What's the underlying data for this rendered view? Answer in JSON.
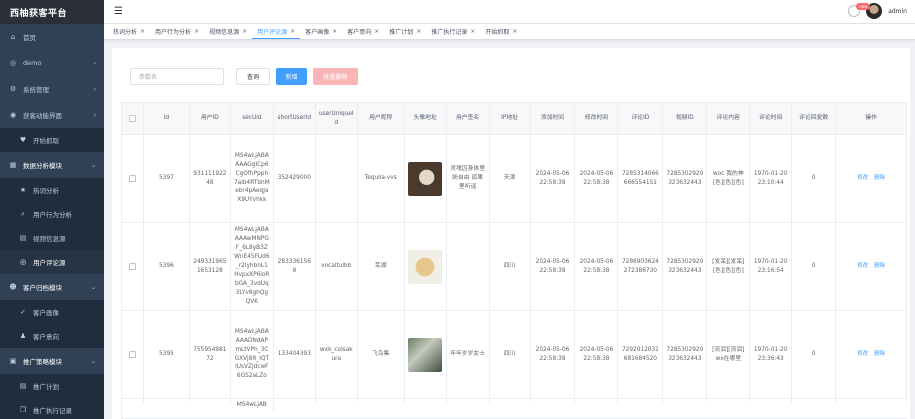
{
  "app": {
    "logo_text": "西柚获客平台"
  },
  "sidebar": {
    "items": [
      {
        "label": "首页",
        "icon": "home-icon"
      },
      {
        "label": "demo",
        "icon": "circle-icon",
        "arrow": "›"
      },
      {
        "label": "系统管理",
        "icon": "gear-icon",
        "arrow": "›"
      },
      {
        "label": "获客动能界面",
        "icon": "circle-icon",
        "arrow": "›"
      }
    ],
    "sub_open_label": "开始抓取",
    "group_data": {
      "label": "数据分析模块",
      "arrow": "⌄"
    },
    "data_subitems": [
      {
        "label": "热词分析",
        "icon": "star-icon"
      },
      {
        "label": "用户行为分析",
        "icon": "search-icon"
      },
      {
        "label": "视频信息源",
        "icon": "doc-icon"
      },
      {
        "label": "用户评论源",
        "icon": "target-icon",
        "active": true
      }
    ],
    "group_customer": {
      "label": "客户归档模块",
      "arrow": "⌄"
    },
    "customer_subitems": [
      {
        "label": "客户画像",
        "icon": "check-icon"
      },
      {
        "label": "客户意向",
        "icon": "person-icon"
      }
    ],
    "group_promo": {
      "label": "推广策略模块",
      "arrow": "⌄"
    },
    "promo_subitems": [
      {
        "label": "推广计划",
        "icon": "doc-icon"
      },
      {
        "label": "推广执行记录",
        "icon": "cube-icon"
      }
    ]
  },
  "topbar": {
    "badge": "new",
    "username": "admin"
  },
  "tabs": [
    {
      "label": "热词分析",
      "close": "×"
    },
    {
      "label": "用户行为分析",
      "close": "×"
    },
    {
      "label": "视频信息源",
      "close": "×"
    },
    {
      "label": "用户评论源",
      "close": "×",
      "active": true
    },
    {
      "label": "客户画像",
      "close": "×"
    },
    {
      "label": "客户意向",
      "close": "×"
    },
    {
      "label": "推广计划",
      "close": "×"
    },
    {
      "label": "推广执行记录",
      "close": "×"
    },
    {
      "label": "开始抓取",
      "close": "×"
    }
  ],
  "toolbar": {
    "search_placeholder": "参数名",
    "query_label": "查询",
    "add_label": "新增",
    "batch_delete_label": "批量删除"
  },
  "table": {
    "headers": [
      "id",
      "用户ID",
      "secUid",
      "shortUserId",
      "userUniqueId",
      "用户昵称",
      "头像地址",
      "用户签名",
      "IP地址",
      "添加时间",
      "修改时间",
      "评论ID",
      "视频ID",
      "评论内容",
      "评论时间",
      "评论回复数",
      "操作"
    ],
    "edit_label": "修改",
    "delete_label": "删除",
    "rows": [
      {
        "id": "5397",
        "uid": "93111192248",
        "secuid": "MS4wLjABAAAAGglCp6CgOfhPpph7alb4RTbhMebr4pAeqJaX9UYvhkk",
        "short_uid": "352429000",
        "unique_id": "",
        "nickname": "Tequila-vvs",
        "avatar": "photo-portrait",
        "signature": "灵魂囚身体里盼自由 孤果里听谣",
        "ip": "天津",
        "add_time": "2024-05-06 22:58:38",
        "mod_time": "2024-05-06 22:58:38",
        "comment_id": "7285314066666554151",
        "video_id": "7285302920323632443",
        "content": "woc 我的神[色][色][色]",
        "comment_time": "1970-01-20 23:10:44",
        "reply_count": "0"
      },
      {
        "id": "5396",
        "uid": "2493319651653128",
        "secuid": "MS4wLjABAAAAwMNPGF_6L8yB3ZWnE45FUd6_r2lyhbnL1HvpxXP6loRbGA_3vdUq3LYv8ghQgQVK",
        "short_uid": "2833361569",
        "unique_id": "vocaltulbb",
        "nickname": "芜湖",
        "avatar": "photo-dog",
        "signature": "",
        "ip": "四川",
        "add_time": "2024-05-06 22:58:38",
        "mod_time": "2024-05-06 22:58:38",
        "comment_id": "7286903624272386730",
        "video_id": "7285302920323632443",
        "content": "[发呆][发呆][色][色][色]",
        "comment_time": "1970-01-20 23:16:54",
        "reply_count": "0"
      },
      {
        "id": "5395",
        "uid": "75595498172",
        "secuid": "MS4wLjABAAAADNdAPmLtVPh_3CGXVj8R_IQTlUsVZjdcwF6GS2aLZo",
        "short_uid": "133404393",
        "unique_id": "wxk_coisakura",
        "nickname": "飞鸟集",
        "avatar": "photo-scenery",
        "signature": "年年岁岁女士",
        "ip": "四川",
        "add_time": "2024-05-06 22:58:38",
        "mod_time": "2024-05-06 22:58:38",
        "comment_id": "7292012031681684520",
        "video_id": "7285302920323632443",
        "content": "[流泪][流泪]wx在哪里",
        "comment_time": "1970-01-20 23:36:43",
        "reply_count": "0"
      }
    ],
    "partial_row_secuid": "MS4wLjAB"
  }
}
